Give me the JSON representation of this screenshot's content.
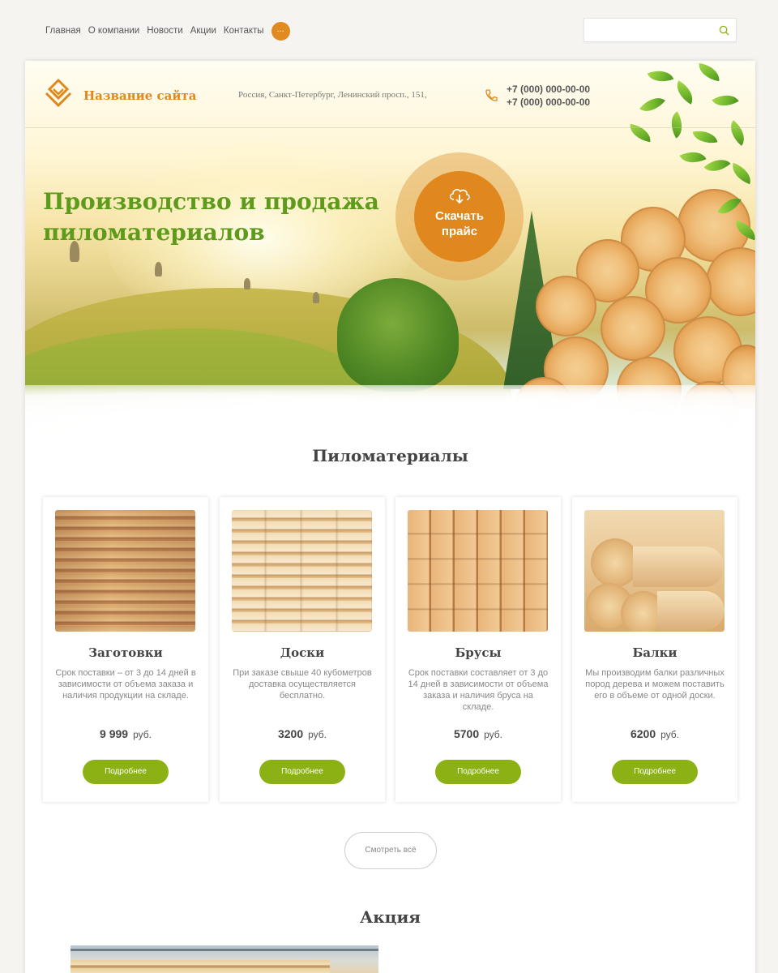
{
  "topnav": {
    "items": [
      {
        "label": "Главная"
      },
      {
        "label": "О компании"
      },
      {
        "label": "Новости"
      },
      {
        "label": "Акции"
      },
      {
        "label": "Контакты"
      }
    ],
    "more_label": "..."
  },
  "search": {
    "placeholder": "",
    "icon": "search-icon"
  },
  "header": {
    "site_name": "Название сайта",
    "address": "Россия, Санкт-Петербург, Ленинский просп., 151,",
    "phone_1": "+7 (000) 000-00-00",
    "phone_2": "+7 (000) 000-00-00"
  },
  "hero": {
    "title_line_1": "Производство и продажа",
    "title_line_2": "пиломатериалов",
    "download_label_1": "Скачать",
    "download_label_2": "прайс"
  },
  "products_section": {
    "title": "Пиломатериалы",
    "items": [
      {
        "name": "Заготовки",
        "description": "Срок поставки – от 3 до 14 дней в зависимости от объема заказа и наличия продукции на складе.",
        "price": "9 999",
        "currency": "руб.",
        "button": "Подробнее"
      },
      {
        "name": "Доски",
        "description": "При заказе свыше 40 кубометров доставка осуществляется бесплатно.",
        "price": "3200",
        "currency": "руб.",
        "button": "Подробнее"
      },
      {
        "name": "Брусы",
        "description": "Срок поставки составляет от 3 до 14 дней в зависимости от объема заказа и наличия бруса на складе.",
        "price": "5700",
        "currency": "руб.",
        "button": "Подробнее"
      },
      {
        "name": "Балки",
        "description": "Мы производим балки различных пород дерева и можем поставить его в объеме от одной доски.",
        "price": "6200",
        "currency": "руб.",
        "button": "Подробнее"
      }
    ],
    "view_all": "Смотреть всё"
  },
  "promo_section": {
    "title": "Акция"
  },
  "colors": {
    "accent_orange": "#e0881d",
    "accent_green": "#8bb114",
    "title_green": "#5e9a1b"
  }
}
